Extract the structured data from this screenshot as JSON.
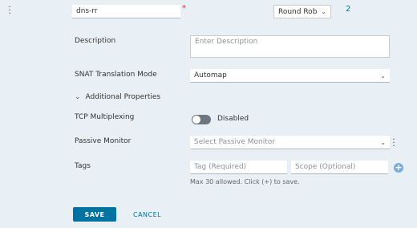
{
  "row": {
    "name_value": "dns-rr",
    "required_mark": "*",
    "algorithm_value": "Round Rob",
    "count": "2"
  },
  "form": {
    "description_label": "Description",
    "description_placeholder": "Enter Description",
    "snat_label": "SNAT Translation Mode",
    "snat_value": "Automap",
    "additional_label": "Additional Properties",
    "tcp_label": "TCP Multiplexing",
    "tcp_state": "Disabled",
    "tcp_enabled": false,
    "passive_label": "Passive Monitor",
    "passive_placeholder": "Select Passive Monitor",
    "tags_label": "Tags",
    "tag_placeholder": "Tag (Required)",
    "scope_placeholder": "Scope (Optional)",
    "tags_hint": "Max 30 allowed. Click (+) to save."
  },
  "actions": {
    "save_label": "SAVE",
    "cancel_label": "CANCEL"
  },
  "colors": {
    "background": "#e9f0f5",
    "primary": "#0072a3",
    "required": "#e02020",
    "toggle_off": "#6e7780",
    "plus": "#7aaedc"
  }
}
